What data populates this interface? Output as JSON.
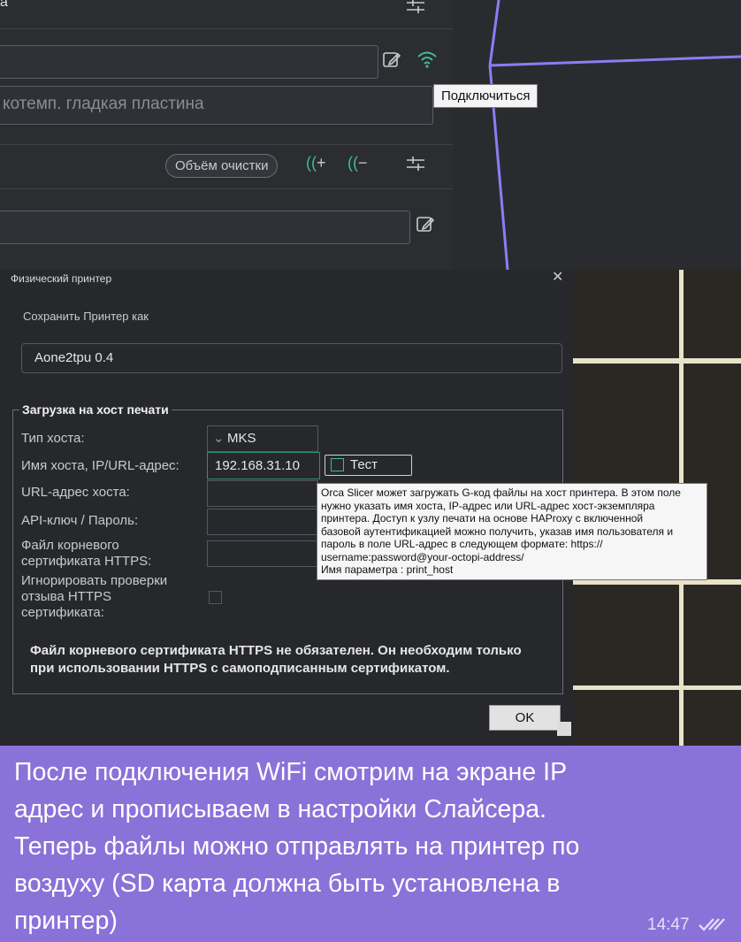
{
  "slicer": {
    "plate_field": "котемп. гладкая пластина",
    "tooltip_connect": "Подключиться",
    "purge_button": "Объём очистки",
    "colors": {
      "accent_wifi": "#3fbf8f",
      "viewport_line": "#8e7cf2"
    }
  },
  "dialog": {
    "title": "Физический принтер",
    "save_as_label": "Сохранить Принтер как",
    "printer_name": "Aone2tpu 0.4",
    "group_title": "Загрузка на хост печати",
    "host_type_label": "Тип хоста:",
    "host_type_value": "MKS",
    "hostname_label": "Имя хоста, IP/URL-адрес:",
    "hostname_value": "192.168.31.10",
    "test_button": "Тест",
    "url_label": "URL-адрес хоста:",
    "api_label": "API-ключ / Пароль:",
    "cert_label_1": "Файл корневого",
    "cert_label_2": "сертификата HTTPS:",
    "ignore_label_1": "Игнорировать проверки",
    "ignore_label_2": "отзыва HTTPS",
    "ignore_label_3": "сертификата:",
    "note_1": "Файл корневого сертификата HTTPS не обязателен. Он необходим только",
    "note_2": "при использовании HTTPS с самоподписанным сертификатом.",
    "ok_button": "OK",
    "tooltip_lines": [
      "Orca Slicer может загружать G-код файлы на хост принтера. В этом поле",
      "нужно указать имя хоста, IP-адрес или URL-адрес хост-экземпляра",
      "принтера. Доступ к узлу печати на основе HAProxy с включенной",
      "базовой аутентификацией можно получить, указав имя пользователя и",
      "пароль в поле URL-адрес в следующем формате: https://",
      "username:password@your-octopi-address/",
      "Имя параметра    : print_host"
    ]
  },
  "message": {
    "caption_lines": [
      "После подключения WiFi смотрим на экране IP",
      "адрес и прописываем в настройки  Слайсера.",
      "Теперь файлы можно отправлять на принтер по",
      "воздуху (SD карта должна быть установлена в",
      "принтер)"
    ],
    "time": "14:47",
    "bubble_color": "#8a72d8"
  }
}
